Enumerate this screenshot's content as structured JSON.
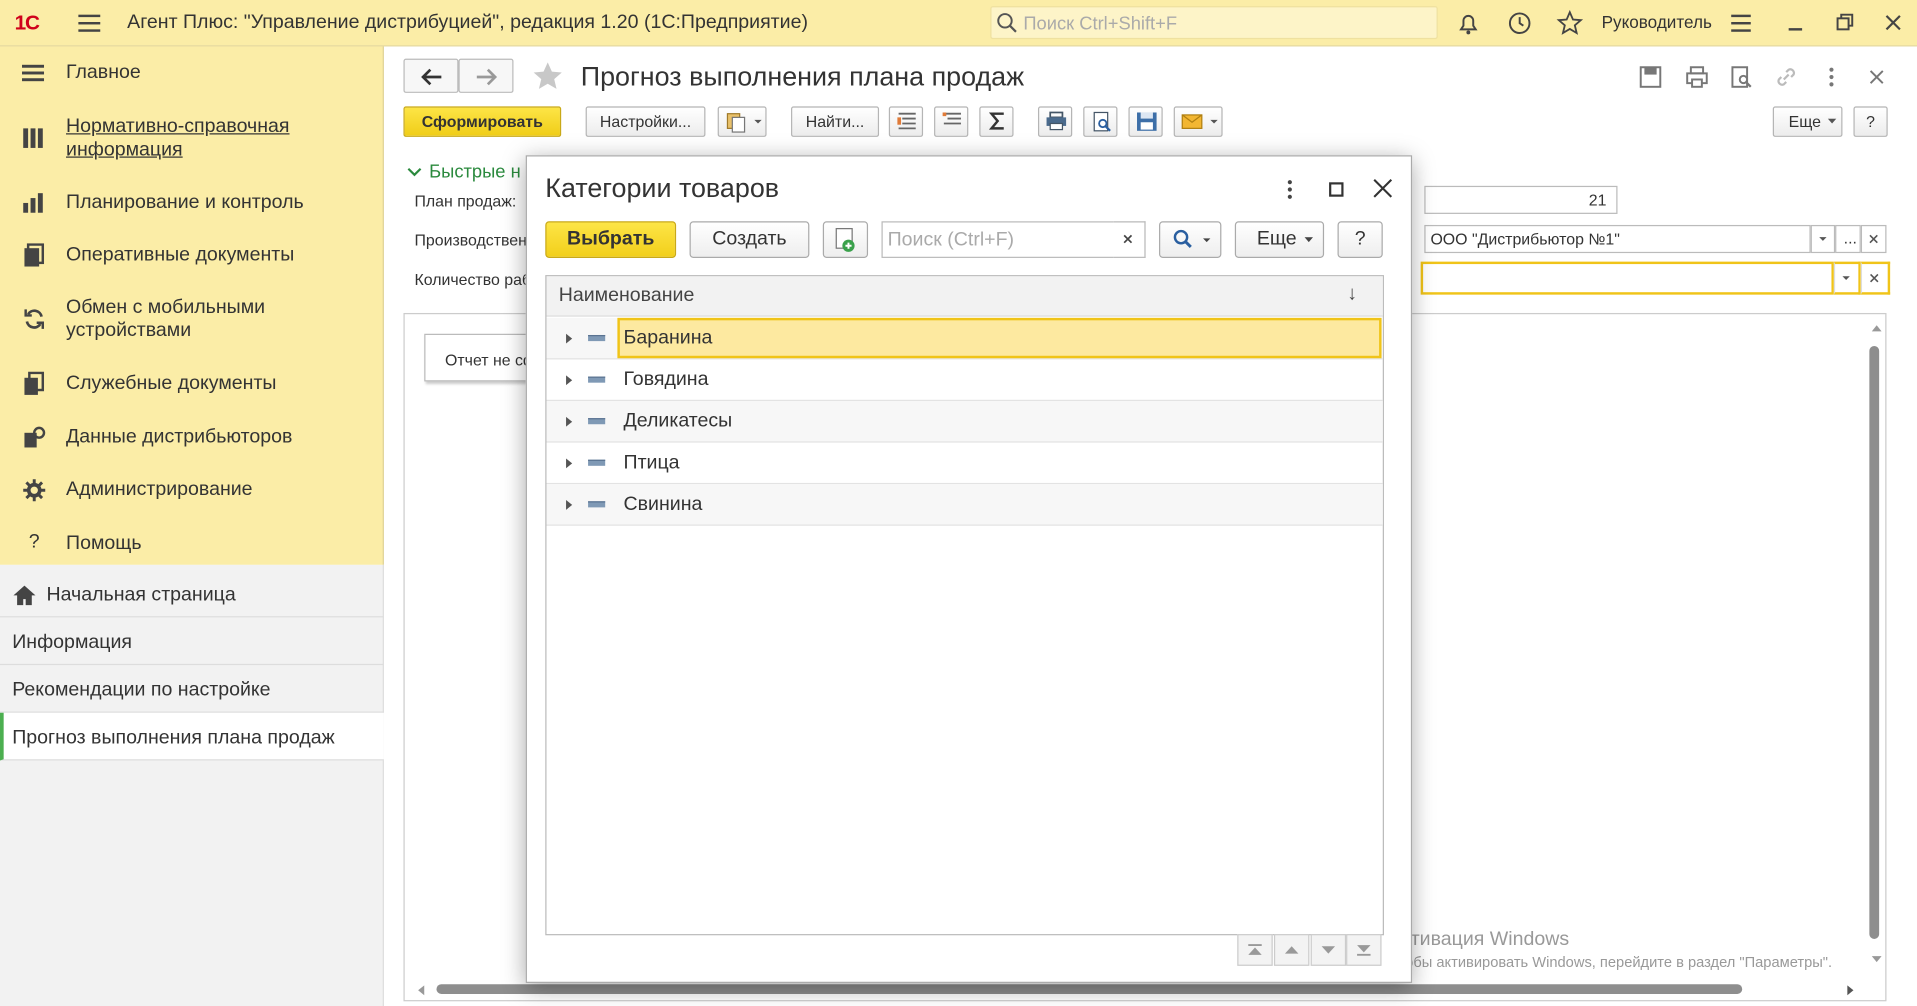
{
  "app": {
    "logo": "1С",
    "title": "Агент Плюс: \"Управление дистрибуцией\", редакция 1.20  (1С:Предприятие)",
    "search_placeholder": "Поиск Ctrl+Shift+F",
    "user": "Руководитель"
  },
  "sidebar": {
    "items": [
      {
        "label": "Главное",
        "icon": "menu-lines-icon"
      },
      {
        "label": "Нормативно-справочная информация",
        "icon": "books-icon"
      },
      {
        "label": "Планирование и контроль",
        "icon": "chart-icon"
      },
      {
        "label": "Оперативные документы",
        "icon": "documents-icon"
      },
      {
        "label": "Обмен с мобильными устройствами",
        "icon": "sync-icon"
      },
      {
        "label": "Служебные документы",
        "icon": "service-docs-icon"
      },
      {
        "label": "Данные дистрибьюторов",
        "icon": "distributor-icon"
      },
      {
        "label": "Администрирование",
        "icon": "gear-icon"
      },
      {
        "label": "Помощь",
        "icon": "question-icon"
      }
    ],
    "bottom_items": [
      {
        "label": "Начальная страница",
        "icon": "home-icon"
      },
      {
        "label": "Информация"
      },
      {
        "label": "Рекомендации по настройке"
      },
      {
        "label": "Прогноз выполнения плана продаж"
      }
    ]
  },
  "main": {
    "title": "Прогноз выполнения плана продаж",
    "toolbar": {
      "generate": "Сформировать",
      "settings": "Настройки...",
      "find": "Найти...",
      "more": "Еще",
      "help": "?"
    },
    "quick_settings": "Быстрые н",
    "fields": {
      "plan_label": "План продаж:",
      "producer_label": "Производствен",
      "count_label": "Количество раб",
      "count_value": "21",
      "distributor_value": "ООО \"Дистрибьютор №1\"",
      "distributor_ellipsis": "..."
    },
    "report_status": "Отчет не сф",
    "watermark_title": "Активация Windows",
    "watermark_text": "Чтобы активировать Windows, перейдите в раздел \"Параметры\"."
  },
  "dialog": {
    "title": "Категории товаров",
    "select": "Выбрать",
    "create": "Создать",
    "search_placeholder": "Поиск (Ctrl+F)",
    "more": "Еще",
    "help": "?",
    "column_header": "Наименование",
    "sort_arrow": "↓",
    "rows": [
      "Баранина",
      "Говядина",
      "Деликатесы",
      "Птица",
      "Свинина"
    ],
    "selected_index": 0
  },
  "colors": {
    "panel_yellow": "#fbeda7",
    "button_yellow": "#f2cf1b",
    "selection": "#fde9a0",
    "active_green": "#4caf50"
  }
}
